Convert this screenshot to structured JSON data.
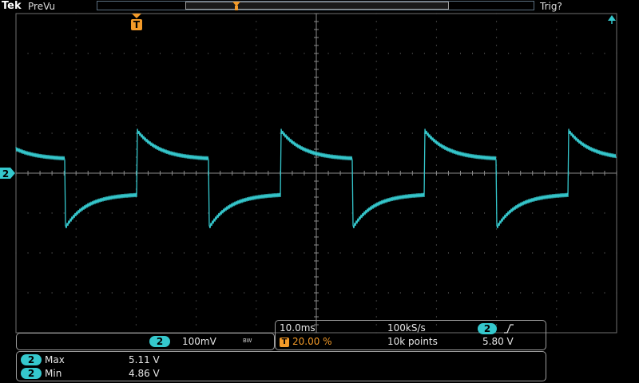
{
  "header": {
    "brand": "Tek",
    "mode": "PreVu",
    "trigger_status": "Trig?"
  },
  "markers": {
    "channel_marker": "2",
    "trigger_marker": "T"
  },
  "channel_box": {
    "channel": "2",
    "scale": "100mV",
    "bandwidth_icon_text": "BW"
  },
  "timebase": {
    "time_per_div": "10.0ms",
    "sample_rate": "100kS/s",
    "record_length": "10k points",
    "trigger_position": "20.00 %",
    "trigger_channel": "2",
    "trigger_slope": "rising-edge-icon",
    "trigger_level": "5.80 V"
  },
  "measurements": [
    {
      "channel": "2",
      "name": "Max",
      "value": "5.11 V"
    },
    {
      "channel": "2",
      "name": "Min",
      "value": "4.86 V"
    }
  ],
  "colors": {
    "ch2": "#35c8cd",
    "trigger": "#f39a29",
    "grid": "#5a5a5a",
    "center_axis": "#8a8a8a",
    "background": "#000000"
  }
}
